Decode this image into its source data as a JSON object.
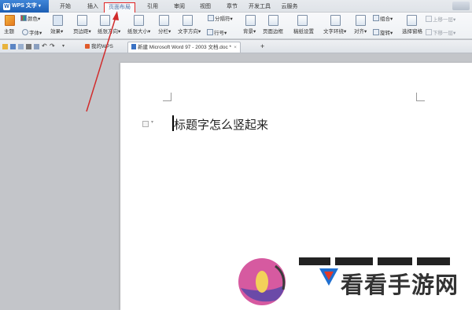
{
  "app": {
    "name": "WPS 文字"
  },
  "tabs": [
    {
      "label": "开始"
    },
    {
      "label": "插入"
    },
    {
      "label": "页面布局",
      "active": true
    },
    {
      "label": "引用"
    },
    {
      "label": "审阅"
    },
    {
      "label": "视图"
    },
    {
      "label": "章节"
    },
    {
      "label": "开发工具"
    },
    {
      "label": "云服务"
    }
  ],
  "ribbon": {
    "theme": "主题",
    "colors": "颜色",
    "fonts": "字体",
    "effects": "效果",
    "margins": "页边距",
    "orientation": "纸张方向",
    "size": "纸张大小",
    "columns": "分栏",
    "text_direction": "文字方向",
    "line_numbers": "行号",
    "breaks": "分隔符",
    "background": "背景",
    "page_border": "页面边框",
    "draft_grid": "稿纸设置",
    "wrap": "文字环绕",
    "align": "对齐",
    "rotate": "旋转",
    "group": "组合",
    "selection_pane": "选择窗格",
    "bring_forward": "上移一层",
    "send_backward": "下移一层"
  },
  "doc_tabs": [
    {
      "label": "我的WPS"
    },
    {
      "label": "新建 Microsoft Word 97 - 2003 文档.doc *",
      "active": true
    }
  ],
  "document": {
    "title_text": "标题字怎么竖起来"
  },
  "watermark": {
    "site": "看看手游网"
  },
  "colors": {
    "accent": "#1e5fb4",
    "highlight": "#e02424"
  }
}
